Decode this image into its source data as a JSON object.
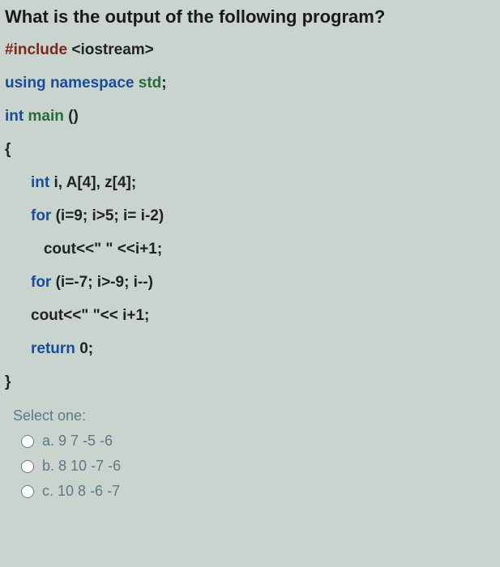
{
  "question": {
    "title": "What is the output of the following program?",
    "code_lines": [
      {
        "segments": [
          {
            "class": "kw-include",
            "text": "#include "
          },
          {
            "class": "plain",
            "text": "<iostream>"
          }
        ],
        "indent": false
      },
      {
        "segments": [
          {
            "class": "kw-blue",
            "text": "using "
          },
          {
            "class": "kw-blue",
            "text": "namespace "
          },
          {
            "class": "kw-green",
            "text": "std"
          },
          {
            "class": "plain",
            "text": ";"
          }
        ],
        "indent": false
      },
      {
        "segments": [
          {
            "class": "kw-blue",
            "text": "int "
          },
          {
            "class": "kw-green",
            "text": "main "
          },
          {
            "class": "plain",
            "text": "()"
          }
        ],
        "indent": false
      },
      {
        "segments": [
          {
            "class": "plain",
            "text": "{"
          }
        ],
        "indent": false
      },
      {
        "segments": [
          {
            "class": "kw-blue",
            "text": "int "
          },
          {
            "class": "plain",
            "text": "i, A[4], z[4];"
          }
        ],
        "indent": true
      },
      {
        "segments": [
          {
            "class": "kw-blue",
            "text": "for "
          },
          {
            "class": "plain",
            "text": "(i=9; i>5; i= i-2)"
          }
        ],
        "indent": true
      },
      {
        "segments": [
          {
            "class": "plain",
            "text": "   cout<<\" \" <<i+1;"
          }
        ],
        "indent": true
      },
      {
        "segments": [
          {
            "class": "kw-blue",
            "text": "for "
          },
          {
            "class": "plain",
            "text": "(i=-7; i>-9; i--)"
          }
        ],
        "indent": true
      },
      {
        "segments": [
          {
            "class": "plain",
            "text": "cout<<\" \"<< i+1;"
          }
        ],
        "indent": true
      },
      {
        "segments": [
          {
            "class": "kw-blue",
            "text": "return "
          },
          {
            "class": "plain",
            "text": "0;"
          }
        ],
        "indent": true
      },
      {
        "segments": [
          {
            "class": "plain",
            "text": "}"
          }
        ],
        "indent": false
      }
    ]
  },
  "answers": {
    "title": "Select one:",
    "options": [
      {
        "letter": "a.",
        "text": "9 7 -5 -6"
      },
      {
        "letter": "b.",
        "text": "8 10 -7 -6"
      },
      {
        "letter": "c.",
        "text": "10 8 -6 -7"
      }
    ]
  }
}
